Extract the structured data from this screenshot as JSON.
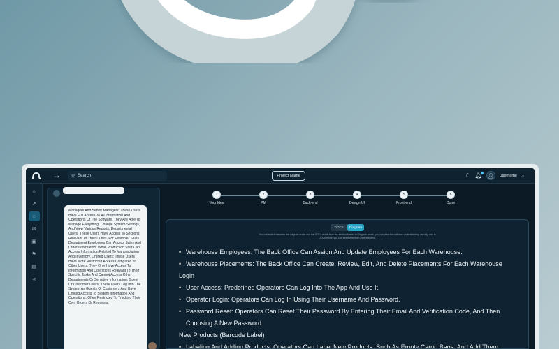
{
  "colors": {
    "accent": "#27a5c9",
    "background": "#0b1a24",
    "panel": "#0f2231"
  },
  "topbar": {
    "search_placeholder": "Search",
    "project_name": "Project Name",
    "username": "Username"
  },
  "rail": {
    "icons": [
      "home-icon",
      "trend-icon",
      "chat-icon",
      "mail-icon",
      "lock-icon",
      "flag-icon",
      "clipboard-icon",
      "share-icon"
    ],
    "active_index": 2
  },
  "chat": {
    "message": "Managers And Senior Managers: These Users Have Full Access To All Information And Operations Of The Software. They Are Able To Manage Everything, Change System Settings, And View Various Reports. Departmental Users: These Users Have Access To Sections Relevant To Their Duties. For Example, Sales Department Employees Can Access Sales And Order Information, While Production Staff Can Access Information Related To Manufacturing And Inventory. Limited Users: These Users Have More Restricted Access Compared To Other Users. They Only Have Access To Information And Operations Relevant To Their Specific Tasks And Cannot Access Other Departments Or Sensitive Information. Guest Or Customer Users: These Users Log Into The System As Guests Or Customers And Have Limited Access To System Information And Operations, Often Restricted To Tracking Their Own Orders Or Requests."
  },
  "stepper": {
    "steps": [
      {
        "num": "1",
        "label": "Your Idea"
      },
      {
        "num": "2",
        "label": "PM"
      },
      {
        "num": "3",
        "label": "Back-end"
      },
      {
        "num": "4",
        "label": "Design UI"
      },
      {
        "num": "5",
        "label": "Front-end"
      },
      {
        "num": "6",
        "label": "Done"
      }
    ]
  },
  "content": {
    "toggle": {
      "docs": "DOCs",
      "diagram": "Diagram",
      "selected": "Diagram"
    },
    "hint": "You can switch between the diagram mode and the DOCs mode from the section below. In Diagram mode, you can view the software understanding visually, and in DOCs mode, you can see the textual understanding.",
    "lines": [
      {
        "type": "bullet",
        "text": "Warehouse Employees: The Back Office Can Assign And Update Employees For Each Warehouse."
      },
      {
        "type": "bullet",
        "text": "Warehouse Placements: The Back Office Can Create, Review, Edit, And Delete Placements For Each Warehouse"
      },
      {
        "type": "plain",
        "text": "Login"
      },
      {
        "type": "bullet",
        "text": "User Access: Predefined Operators Can Log Into The App And Use It."
      },
      {
        "type": "bullet",
        "text": "Operator Login: Operators Can Log In Using Their Username And Password."
      },
      {
        "type": "bullet",
        "text": "Password Reset: Operators Can Reset Their Password By Entering Their Email And Verification Code, And Then"
      },
      {
        "type": "cont",
        "text": "Choosing A New Password."
      },
      {
        "type": "plain",
        "text": "New Products (Barcode Label)"
      },
      {
        "type": "bullet",
        "text": "Labeling And Adding Products: Operators Can Label New Products, Such As Empty Cargo Bags, And Add Them"
      }
    ]
  }
}
